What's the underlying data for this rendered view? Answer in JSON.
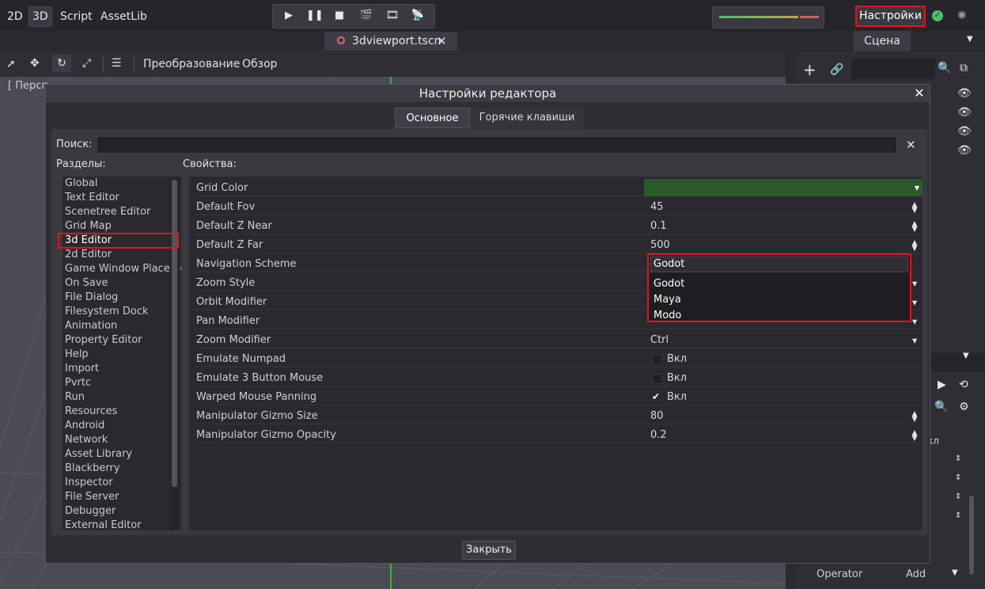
{
  "top": {
    "mode_tabs": [
      "2D",
      "3D",
      "Script",
      "AssetLib"
    ],
    "settings_label": "Настройки",
    "scene_tab": "Сцена",
    "file_tab": "3dviewport.tscn"
  },
  "toolbar": {
    "transform_menu": "Преобразование",
    "view_menu": "Обзор",
    "viewport_label": "[ Персп"
  },
  "dock": {
    "operator_label": "Operator",
    "add_value": "Add",
    "partial_text": "кл"
  },
  "dialog": {
    "title": "Настройки редактора",
    "tabs": [
      "Основное",
      "Горячие клавиши"
    ],
    "search_label": "Поиск:",
    "sections_label": "Разделы:",
    "properties_label": "Свойства:",
    "close_button": "Закрыть",
    "sections": [
      "Global",
      "Text Editor",
      "Scenetree Editor",
      "Grid Map",
      "3d Editor",
      "2d Editor",
      "Game Window Placement",
      "On Save",
      "File Dialog",
      "Filesystem Dock",
      "Animation",
      "Property Editor",
      "Help",
      "Import",
      "Pvrtc",
      "Run",
      "Resources",
      "Android",
      "Network",
      "Asset Library",
      "Blackberry",
      "Inspector",
      "File Server",
      "Debugger",
      "External Editor"
    ],
    "selected_section": "3d Editor",
    "properties": [
      {
        "name": "Grid Color",
        "value": ""
      },
      {
        "name": "Default Fov",
        "value": "45"
      },
      {
        "name": "Default Z Near",
        "value": "0.1"
      },
      {
        "name": "Default Z Far",
        "value": "500"
      },
      {
        "name": "Navigation Scheme",
        "value": "Godot"
      },
      {
        "name": "Zoom Style",
        "value": ""
      },
      {
        "name": "Orbit Modifier",
        "value": ""
      },
      {
        "name": "Pan Modifier",
        "value": ""
      },
      {
        "name": "Zoom Modifier",
        "value": "Ctrl"
      },
      {
        "name": "Emulate Numpad",
        "value": "Вкл"
      },
      {
        "name": "Emulate 3 Button Mouse",
        "value": "Вкл"
      },
      {
        "name": "Warped Mouse Panning",
        "value": "Вкл"
      },
      {
        "name": "Manipulator Gizmo Size",
        "value": "80"
      },
      {
        "name": "Manipulator Gizmo Opacity",
        "value": "0.2"
      }
    ],
    "nav_scheme_options": [
      "Godot",
      "Maya",
      "Modo"
    ],
    "colors": {
      "grid_color": "#2a5a2a",
      "highlight": "#e0161c"
    }
  }
}
